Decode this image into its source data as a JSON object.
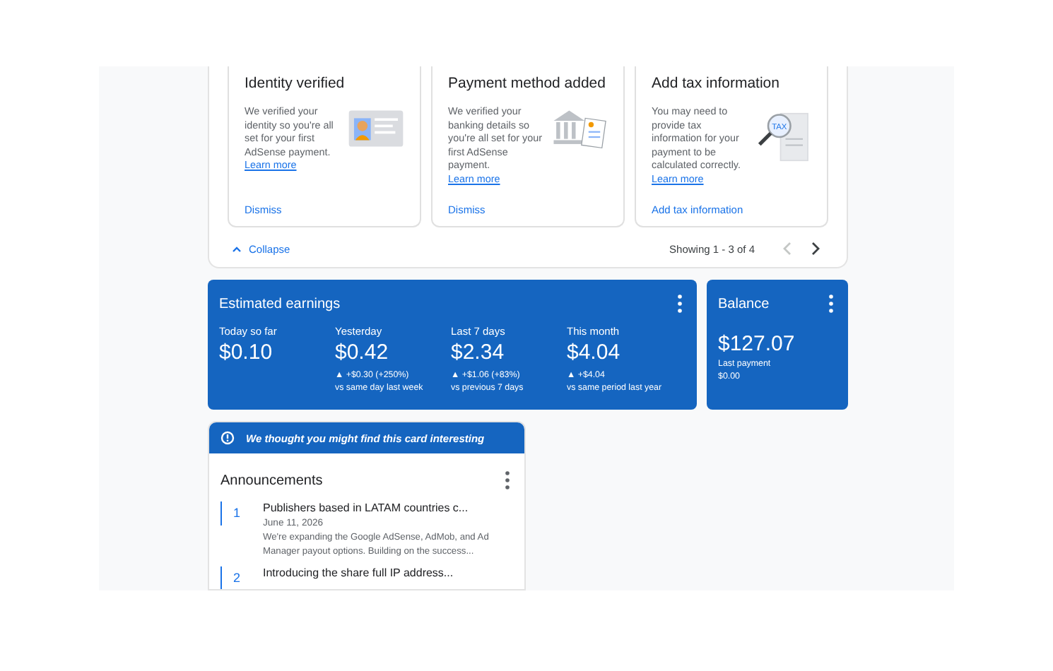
{
  "tasks": {
    "cards": [
      {
        "title": "Identity verified",
        "body": "We verified your identity so you're all set for your first AdSense payment.",
        "link": "Learn more",
        "action": "Dismiss",
        "kind": "id-card"
      },
      {
        "title": "Payment method added",
        "body": "We verified your banking details so you're all set for your first AdSense payment.",
        "link": "Learn more",
        "action": "Dismiss",
        "kind": "bank"
      },
      {
        "title": "Add tax information",
        "body": "You may need to provide tax information for your payment to be calculated correctly.",
        "link": "Learn more",
        "action": "Add tax information",
        "kind": "tax",
        "illustration_text": "TAX"
      }
    ],
    "collapse": "Collapse",
    "paging": "Showing 1 - 3 of 4",
    "prev_disabled": true,
    "next_disabled": false
  },
  "earnings": {
    "title": "Estimated earnings",
    "metrics": [
      {
        "label": "Today so far",
        "value": "$0.10"
      },
      {
        "label": "Yesterday",
        "value": "$0.42",
        "change": "▲ +$0.30 (+250%)",
        "compare": "vs same day last week"
      },
      {
        "label": "Last 7 days",
        "value": "$2.34",
        "change": "▲ +$1.06 (+83%)",
        "compare": "vs previous 7 days"
      },
      {
        "label": "This month",
        "value": "$4.04",
        "change": "▲ +$4.04",
        "compare": "vs same period last year"
      }
    ]
  },
  "balance": {
    "title": "Balance",
    "value": "$127.07",
    "last_label": "Last payment",
    "last_value": "$0.00"
  },
  "announcements": {
    "banner": "We thought you might find this card interesting",
    "title": "Announcements",
    "items": [
      {
        "number": "1",
        "title": "Publishers based in LATAM countries c...",
        "date": "June 11, 2026",
        "summary": "We're expanding the Google AdSense, AdMob, and Ad Manager payout options. Building on the success..."
      },
      {
        "number": "2",
        "title": "Introducing the share full IP address..."
      }
    ]
  }
}
